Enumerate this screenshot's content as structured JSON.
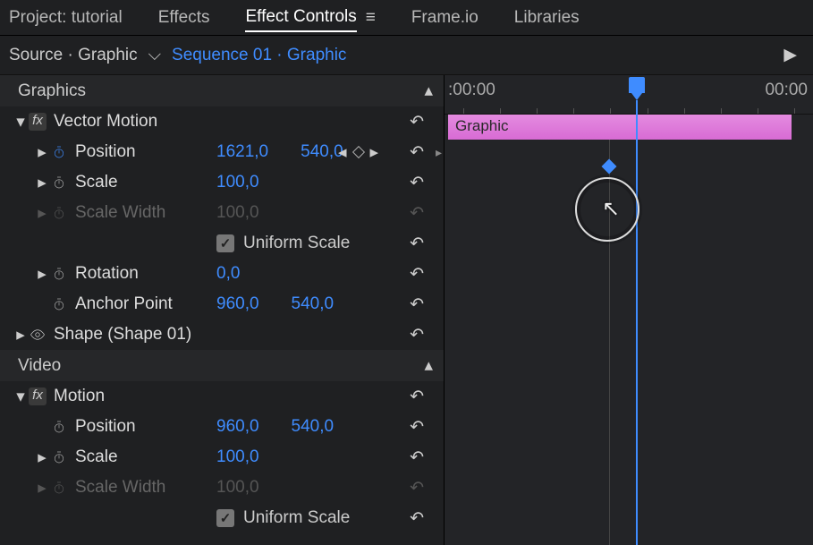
{
  "tabs": {
    "project": "Project: tutorial",
    "effects": "Effects",
    "effect_controls": "Effect Controls",
    "frameio": "Frame.io",
    "libraries": "Libraries"
  },
  "source": {
    "label": "Source · Graphic",
    "sequence": "Sequence 01 · Graphic"
  },
  "sections": {
    "graphics": "Graphics",
    "video": "Video"
  },
  "graphics": {
    "vector_motion": "Vector Motion",
    "position": {
      "name": "Position",
      "x": "1621,0",
      "y": "540,0"
    },
    "scale": {
      "name": "Scale",
      "v": "100,0"
    },
    "scale_width": {
      "name": "Scale Width",
      "v": "100,0"
    },
    "uniform_scale": "Uniform Scale",
    "rotation": {
      "name": "Rotation",
      "v": "0,0"
    },
    "anchor": {
      "name": "Anchor Point",
      "x": "960,0",
      "y": "540,0"
    },
    "shape": "Shape (Shape 01)"
  },
  "video": {
    "motion": "Motion",
    "position": {
      "name": "Position",
      "x": "960,0",
      "y": "540,0"
    },
    "scale": {
      "name": "Scale",
      "v": "100,0"
    },
    "scale_width": {
      "name": "Scale Width",
      "v": "100,0"
    },
    "uniform_scale": "Uniform Scale"
  },
  "timeline": {
    "t0": ":00:00",
    "t1": "00:00",
    "clip": "Graphic"
  }
}
